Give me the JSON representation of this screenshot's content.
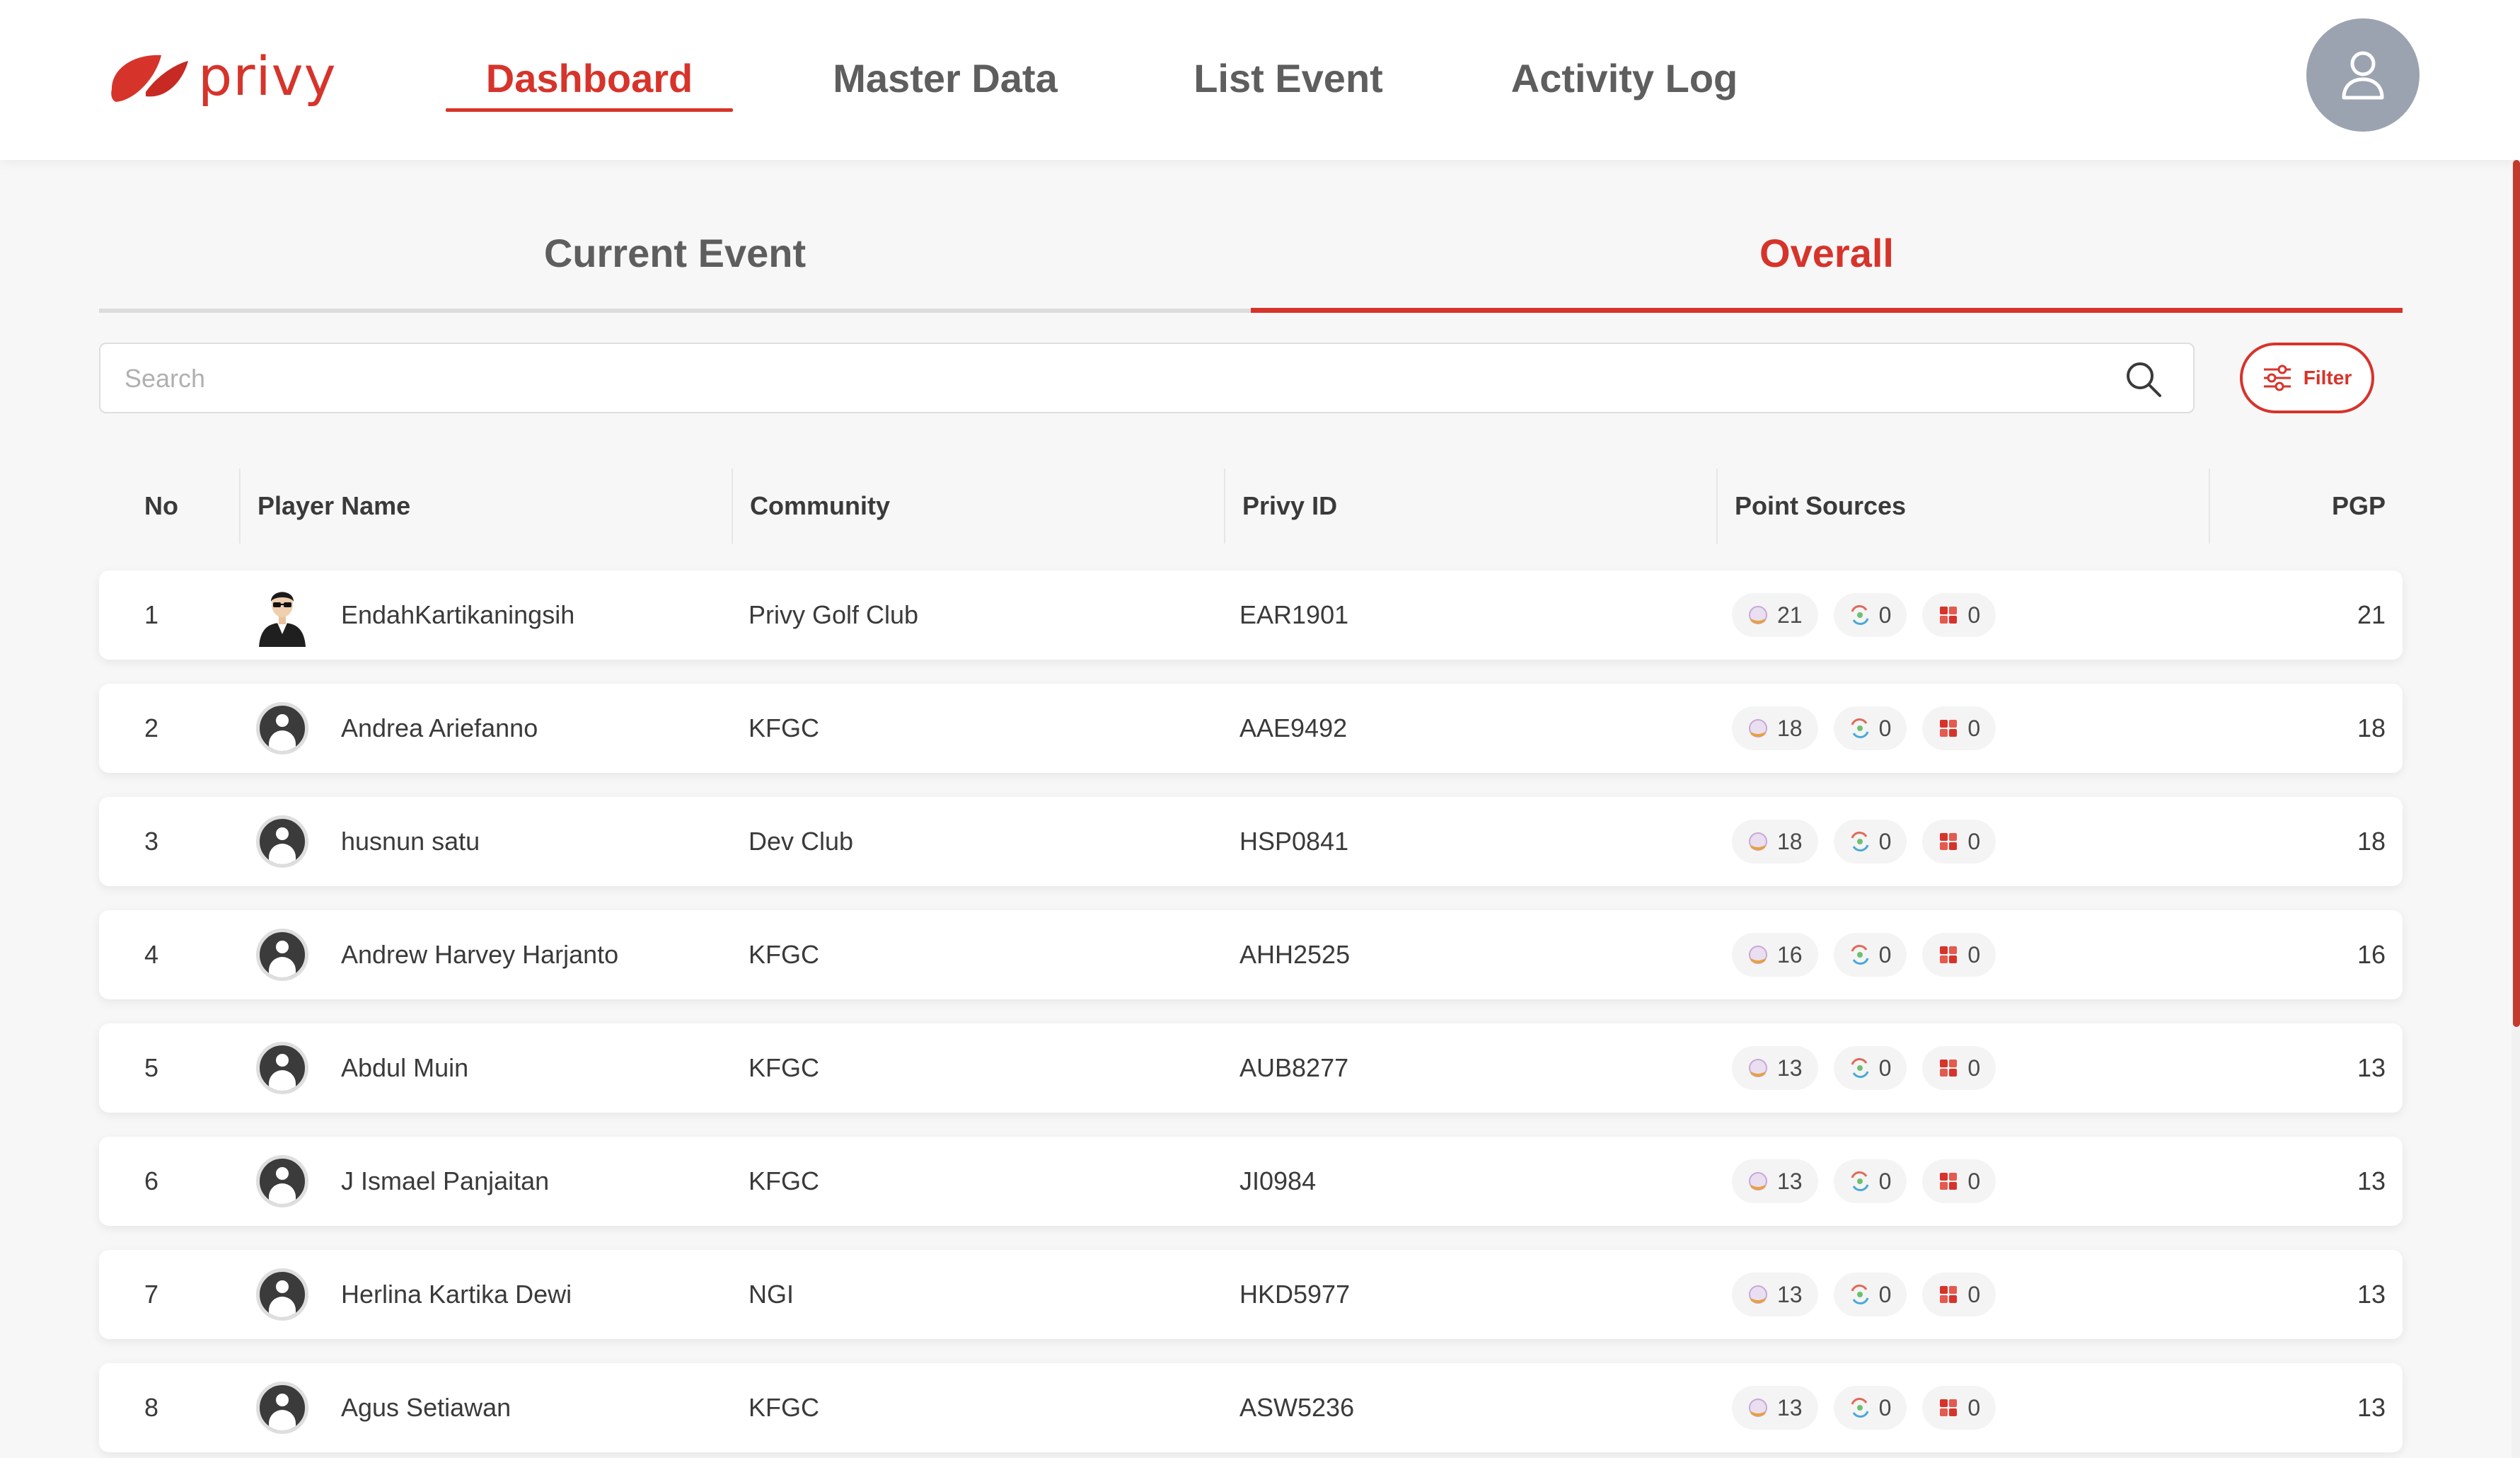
{
  "app": {
    "logo_text": "privy"
  },
  "nav": [
    {
      "label": "Dashboard",
      "active": true
    },
    {
      "label": "Master Data",
      "active": false
    },
    {
      "label": "List Event",
      "active": false
    },
    {
      "label": "Activity Log",
      "active": false
    }
  ],
  "tabs": [
    {
      "label": "Current Event",
      "active": false
    },
    {
      "label": "Overall",
      "active": true
    }
  ],
  "search": {
    "placeholder": "Search",
    "value": ""
  },
  "filter": {
    "label": "Filter"
  },
  "table": {
    "headers": {
      "no": "No",
      "player_name": "Player Name",
      "community": "Community",
      "privy_id": "Privy ID",
      "point_sources": "Point Sources",
      "pgp": "PGP"
    },
    "rows": [
      {
        "no": "1",
        "name": "EndahKartikaningsih",
        "community": "Privy Golf Club",
        "privy_id": "EAR1901",
        "sources": [
          "21",
          "0",
          "0"
        ],
        "pgp": "21",
        "avatar": "photo"
      },
      {
        "no": "2",
        "name": "Andrea Ariefanno",
        "community": "KFGC",
        "privy_id": "AAE9492",
        "sources": [
          "18",
          "0",
          "0"
        ],
        "pgp": "18",
        "avatar": "default"
      },
      {
        "no": "3",
        "name": "husnun satu",
        "community": "Dev Club",
        "privy_id": "HSP0841",
        "sources": [
          "18",
          "0",
          "0"
        ],
        "pgp": "18",
        "avatar": "default"
      },
      {
        "no": "4",
        "name": "Andrew Harvey Harjanto",
        "community": "KFGC",
        "privy_id": "AHH2525",
        "sources": [
          "16",
          "0",
          "0"
        ],
        "pgp": "16",
        "avatar": "default"
      },
      {
        "no": "5",
        "name": "Abdul Muin",
        "community": "KFGC",
        "privy_id": "AUB8277",
        "sources": [
          "13",
          "0",
          "0"
        ],
        "pgp": "13",
        "avatar": "default"
      },
      {
        "no": "6",
        "name": "J Ismael Panjaitan",
        "community": "KFGC",
        "privy_id": "JI0984",
        "sources": [
          "13",
          "0",
          "0"
        ],
        "pgp": "13",
        "avatar": "default"
      },
      {
        "no": "7",
        "name": "Herlina Kartika Dewi",
        "community": "NGI",
        "privy_id": "HKD5977",
        "sources": [
          "13",
          "0",
          "0"
        ],
        "pgp": "13",
        "avatar": "default"
      },
      {
        "no": "8",
        "name": "Agus Setiawan",
        "community": "KFGC",
        "privy_id": "ASW5236",
        "sources": [
          "13",
          "0",
          "0"
        ],
        "pgp": "13",
        "avatar": "default"
      }
    ]
  },
  "colors": {
    "brand": "#d6342b",
    "nav_text": "#5e5e5e",
    "avatar_bg": "#9ba3b0",
    "row_bg": "#ffffff",
    "page_bg": "#f7f7f7"
  },
  "icons": {
    "point_sources": [
      "golf-ball-icon",
      "swap-icon",
      "grid-icon"
    ],
    "profile": "user-icon",
    "search": "search-icon",
    "filter": "sliders-icon"
  }
}
